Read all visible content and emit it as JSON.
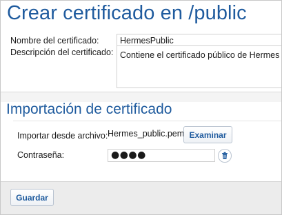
{
  "page": {
    "title": "Crear certificado en /public"
  },
  "certificate": {
    "name_label": "Nombre del certificado:",
    "name_value": "HermesPublic",
    "description_label": "Descripción del certificado:",
    "description_value": "Contiene el certificado público de Hermes"
  },
  "import": {
    "section_title": "Importación de certificado",
    "file_label": "Importar desde archivo:",
    "file_name": "Hermes_public.pem",
    "browse_label": "Examinar",
    "password_label": "Contraseña:",
    "password_mask": "●●●●"
  },
  "footer": {
    "save_label": "Guardar"
  },
  "colors": {
    "accent": "#1f5b9e",
    "footer_background": "#ececec"
  },
  "icons": {
    "clear_password": "trash-icon"
  }
}
